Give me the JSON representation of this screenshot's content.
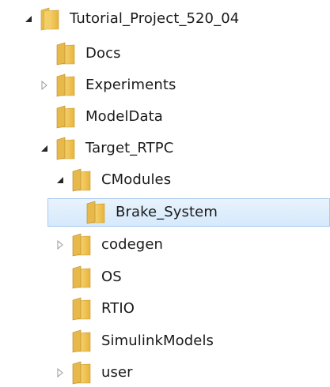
{
  "tree": {
    "items": [
      {
        "label": "Tutorial_Project_520_04",
        "toggle": "expanded",
        "selected": false
      },
      {
        "label": "Docs",
        "toggle": "none",
        "selected": false
      },
      {
        "label": "Experiments",
        "toggle": "collapsed",
        "selected": false
      },
      {
        "label": "ModelData",
        "toggle": "none",
        "selected": false
      },
      {
        "label": "Target_RTPC",
        "toggle": "expanded",
        "selected": false
      },
      {
        "label": "CModules",
        "toggle": "expanded",
        "selected": false
      },
      {
        "label": "Brake_System",
        "toggle": "none",
        "selected": true
      },
      {
        "label": "codegen",
        "toggle": "collapsed",
        "selected": false
      },
      {
        "label": "OS",
        "toggle": "none",
        "selected": false
      },
      {
        "label": "RTIO",
        "toggle": "none",
        "selected": false
      },
      {
        "label": "SimulinkModels",
        "toggle": "none",
        "selected": false
      },
      {
        "label": "user",
        "toggle": "collapsed",
        "selected": false
      }
    ]
  },
  "icons": {
    "folder": "folder-icon",
    "expanded": "expanded-arrow-icon",
    "collapsed": "collapsed-arrow-icon"
  },
  "colors": {
    "selection_fill": "#d9ebfc",
    "selection_border": "#a9cbef",
    "folder_yellow": "#f5cf5a",
    "text": "#1a1a1a"
  }
}
